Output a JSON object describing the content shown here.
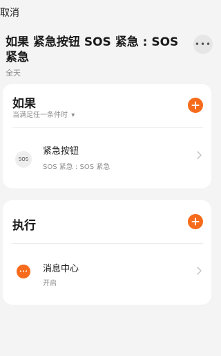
{
  "header": {
    "cancel_label": "取消",
    "title": "如果 紧急按钮 SOS 紧急 : SOS 紧急",
    "subtitle": "全天",
    "more_label": "•••"
  },
  "condition_card": {
    "title": "如果",
    "mode_label": "当满足任一条件时",
    "mode_arrow": "▾",
    "items": [
      {
        "icon_text": "SOS",
        "title": "紧急按钮",
        "subtitle": "SOS 紧急 : SOS 紧急"
      }
    ]
  },
  "action_card": {
    "title": "执行",
    "items": [
      {
        "icon_text": "•••",
        "title": "消息中心",
        "subtitle": "开启"
      }
    ]
  },
  "colors": {
    "accent": "#f76b1c",
    "background": "#f4f4f4",
    "card": "#ffffff",
    "secondary_text": "#8c8c8c"
  },
  "icons": {
    "add": "plus-icon",
    "more": "more-dots-icon",
    "chevron": "chevron-right-icon",
    "sos": "sos-button-icon",
    "message": "message-bubble-icon"
  }
}
